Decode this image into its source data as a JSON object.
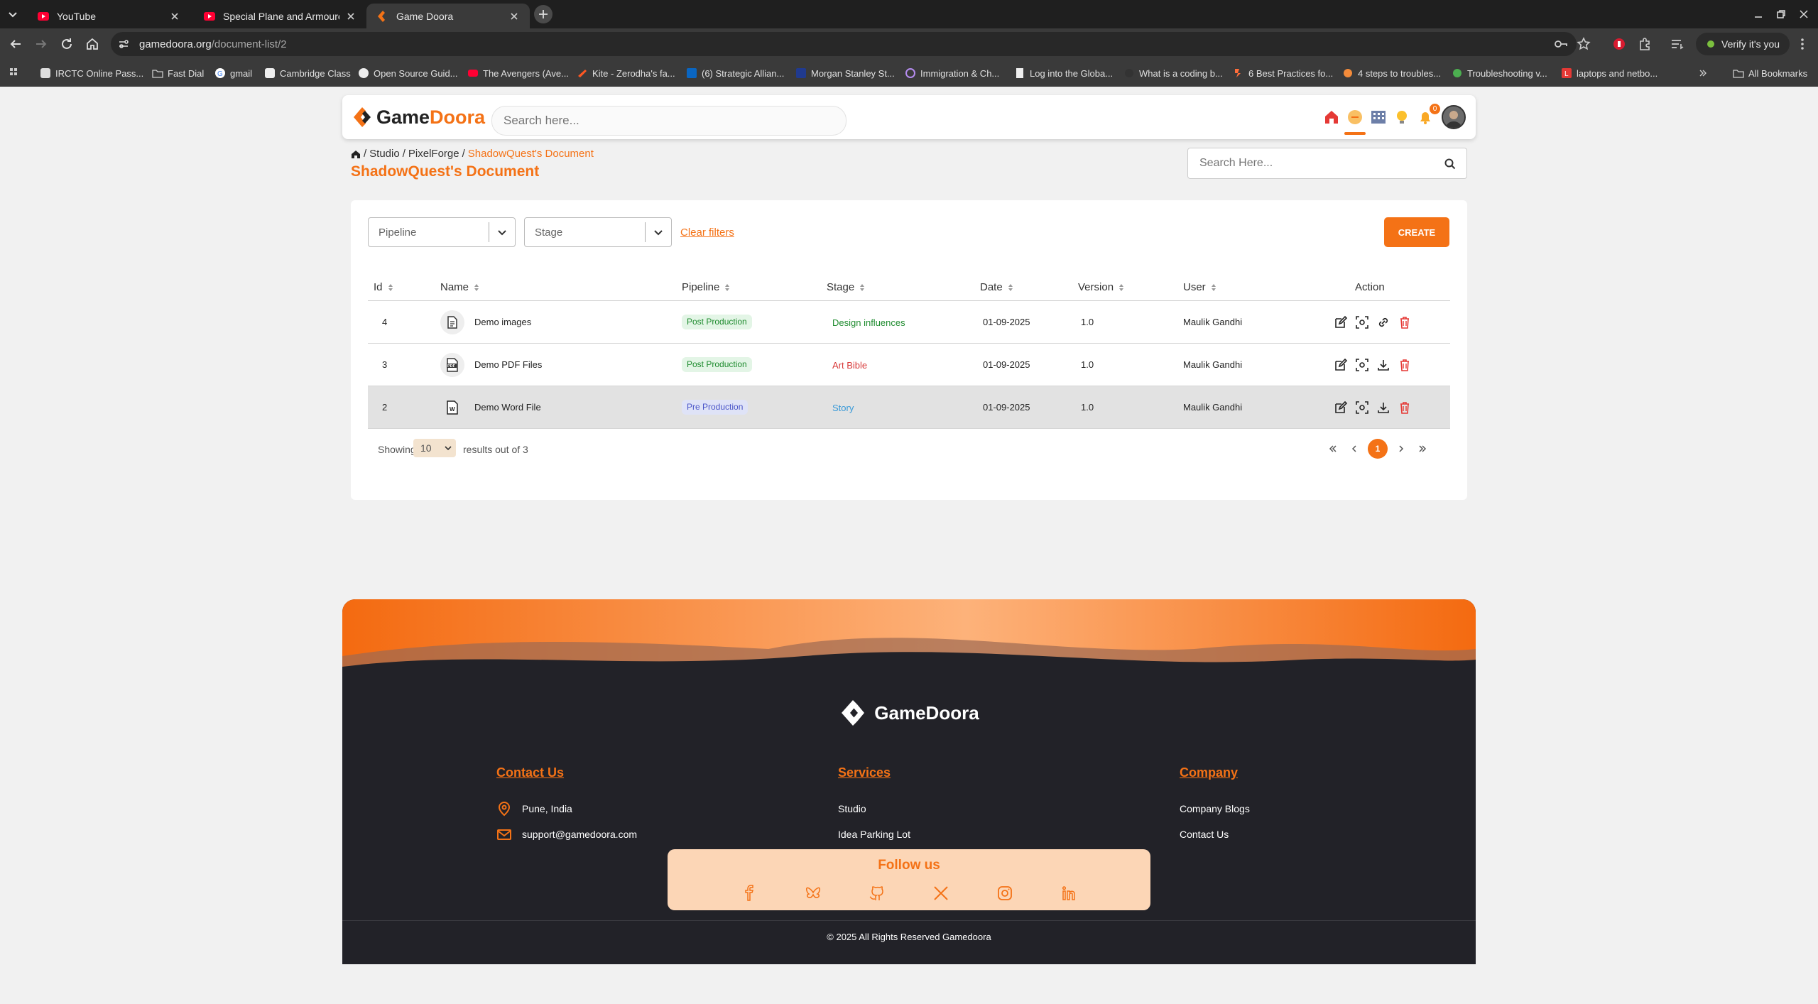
{
  "browser": {
    "tabs": [
      {
        "title": "YouTube",
        "icon": "youtube-icon"
      },
      {
        "title": "Special Plane and Armoured",
        "icon": "youtube-icon"
      },
      {
        "title": "Game Doora",
        "icon": "gamedoora-icon"
      }
    ],
    "url_host": "gamedoora.org",
    "url_path": "/document-list/2",
    "verify_label": "Verify it's you",
    "bookmarks": [
      "IRCTC Online Pass...",
      "Fast Dial",
      "gmail",
      "Cambridge Class",
      "Open Source Guid...",
      "The Avengers (Ave...",
      "Kite - Zerodha's fa...",
      "(6) Strategic Allian...",
      "Morgan Stanley St...",
      "Immigration & Ch...",
      "Log into the Globa...",
      "What is a coding b...",
      "6 Best Practices fo...",
      "4 steps to troubles...",
      "Troubleshooting v...",
      "laptops and netbo..."
    ],
    "all_bookmarks": "All Bookmarks"
  },
  "header": {
    "logo_game": "Game",
    "logo_doora": "Doora",
    "search_placeholder": "Search here...",
    "notification_count": "0",
    "accent": "#f47216"
  },
  "breadcrumb": {
    "items": [
      "Studio",
      "PixelForge"
    ],
    "current": "ShadowQuest's Document"
  },
  "page_title": "ShadowQuest's Document",
  "side_search_placeholder": "Search Here...",
  "filters": {
    "pipeline": "Pipeline",
    "stage": "Stage",
    "clear": "Clear filters",
    "create": "CREATE"
  },
  "table": {
    "headers": [
      "Id",
      "Name",
      "Pipeline",
      "Stage",
      "Date",
      "Version",
      "User",
      "Action"
    ],
    "rows": [
      {
        "id": "4",
        "name": "Demo images",
        "pipeline": "Post Production",
        "stage": "Design influences",
        "date": "01-09-2025",
        "version": "1.0",
        "user": "Maulik Gandhi",
        "file_icon": "document-icon",
        "third_action": "link-icon"
      },
      {
        "id": "3",
        "name": "Demo PDF Files",
        "pipeline": "Post Production",
        "stage": "Art Bible",
        "date": "01-09-2025",
        "version": "1.0",
        "user": "Maulik Gandhi",
        "file_icon": "pdf-icon",
        "third_action": "download-icon"
      },
      {
        "id": "2",
        "name": "Demo Word File",
        "pipeline": "Pre Production",
        "stage": "Story",
        "date": "01-09-2025",
        "version": "1.0",
        "user": "Maulik Gandhi",
        "file_icon": "word-icon",
        "third_action": "download-icon"
      }
    ],
    "stage_colors": {
      "Design influences": "#1e8b2e",
      "Art Bible": "#d83a3a",
      "Story": "#3a9ad8"
    }
  },
  "pagination": {
    "showing": "Showing",
    "per_page": "10",
    "results": "results out of 3",
    "current_page": "1"
  },
  "footer": {
    "logo": "GameDoora",
    "contact_title": "Contact Us",
    "location": "Pune, India",
    "email": "support@gamedoora.com",
    "services_title": "Services",
    "services": [
      "Studio",
      "Idea Parking Lot"
    ],
    "company_title": "Company",
    "company": [
      "Company Blogs",
      "Contact Us"
    ],
    "follow_title": "Follow us",
    "socials": [
      "facebook-icon",
      "bluesky-icon",
      "github-icon",
      "x-icon",
      "instagram-icon",
      "linkedin-icon"
    ],
    "copyright": "© 2025 All Rights Reserved Gamedoora"
  }
}
